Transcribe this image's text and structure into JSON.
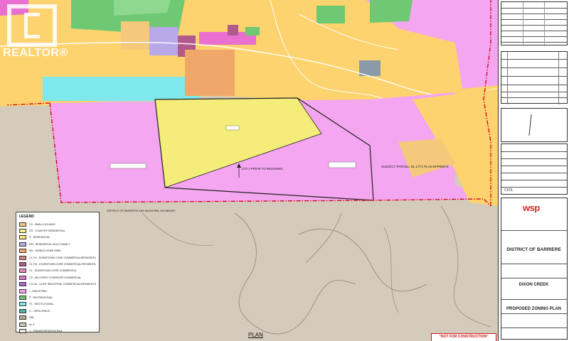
{
  "map": {
    "labels": {
      "subject_parcel": "SUBJECT PARCEL: DL 1771 PLAN EPP85578",
      "lot_2_rezoning": "LOT 2 PRIOR TO REZONING",
      "district_boundary": "DISTRICT OF BARRIÈRE AND MUNICIPAL BOUNDARY",
      "plan_label": "PLAN"
    },
    "colors": {
      "pink_zone": "#f5a6f0",
      "yellow_zone": "#f4ed7a",
      "residential": "#fcd36e",
      "cyan_zone": "#7fe8ec",
      "green_zone": "#6fc873",
      "crown_land": "#d5cbbc",
      "boundary_red": "#d3001a"
    }
  },
  "watermark": {
    "brand": "REALTOR®"
  },
  "legend": {
    "title": "LEGEND",
    "items": [
      {
        "color": "#f4c97c",
        "label": "C9 - SMALL HOLDING"
      },
      {
        "color": "#f5f08a",
        "label": "CR - COUNTRY RESIDENTIAL"
      },
      {
        "color": "#fde27a",
        "label": "R - RESIDENTIAL"
      },
      {
        "color": "#b9a8e8",
        "label": "RM - RESIDENTIAL MULTI-FAMILY"
      },
      {
        "color": "#f0a86a",
        "label": "MH - MOBILE HOME PARK"
      },
      {
        "color": "#d68282",
        "label": "C1-TH - DOWNTOWN CORE COMMERCIAL/RESIDENTIAL"
      },
      {
        "color": "#b25a8c",
        "label": "C1-TM - DOWNTOWN CORE COMMERCIAL/RESIDENTIAL MULTI-FAMILY"
      },
      {
        "color": "#e58ab8",
        "label": "C1 - DOWNTOWN CORE COMMERCIAL"
      },
      {
        "color": "#e96fd0",
        "label": "C2 - HILLCREST CORRIDOR COMMERCIAL"
      },
      {
        "color": "#a86ad0",
        "label": "C3-I-M - LIGHT INDUSTRIAL COMMERCIAL/RESIDENTIAL"
      },
      {
        "color": "#f7a0ef",
        "label": "I - INDUSTRIAL"
      },
      {
        "color": "#6fc873",
        "label": "P - RECREATIONAL"
      },
      {
        "color": "#7fe8ec",
        "label": "P1 - INSTITUTIONAL"
      },
      {
        "color": "#54b4a8",
        "label": "O - OPEN SPACE"
      },
      {
        "color": "#b8aa98",
        "label": "RRL"
      },
      {
        "color": "#cfc6b6",
        "label": "AL-1"
      },
      {
        "color": "#e8e2d5",
        "label": "T - TRANSPORTATION RAIL"
      }
    ]
  },
  "title_block": {
    "consultant": "wsp",
    "client": "DISTRICT OF BARRIERE",
    "project": "DIXON CREEK",
    "drawing_title": "PROPOSED ZONING PLAN",
    "seal_mark": "CIVIL"
  },
  "stamp": {
    "text": "\"NOT FOR CONSTRUCTION\""
  }
}
